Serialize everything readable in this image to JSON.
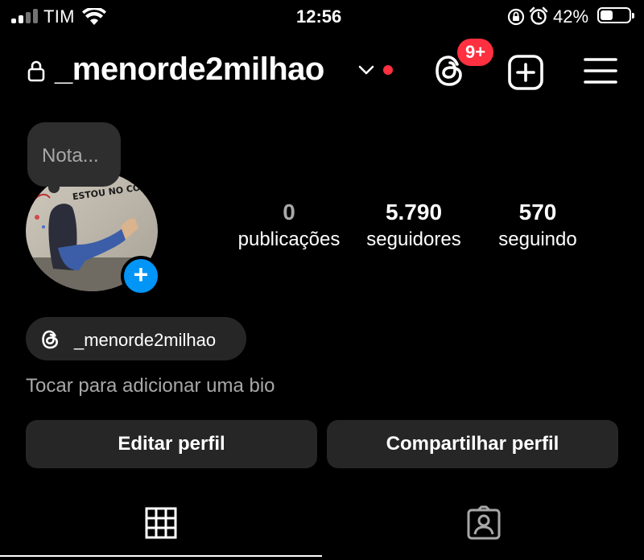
{
  "status_bar": {
    "carrier": "TIM",
    "time": "12:56",
    "battery": "42%"
  },
  "header": {
    "username": "_menorde2milhao",
    "threads_badge": "9+"
  },
  "note": {
    "placeholder": "Nota..."
  },
  "avatar": {
    "art_text": "ESTOU NO CONTROLE!"
  },
  "stats": [
    {
      "value": "0",
      "label": "publicações"
    },
    {
      "value": "5.790",
      "label": "seguidores"
    },
    {
      "value": "570",
      "label": "seguindo"
    }
  ],
  "threads_link": {
    "label": "_menorde2milhao"
  },
  "bio": {
    "placeholder": "Tocar para adicionar uma bio"
  },
  "actions": {
    "edit": "Editar perfil",
    "share": "Compartilhar perfil"
  },
  "tabs": {
    "active": "grid",
    "items": [
      "grid-icon",
      "tagged-icon"
    ]
  },
  "colors": {
    "badge": "#ff3040",
    "accent": "#0095f6",
    "surface": "#262626"
  }
}
